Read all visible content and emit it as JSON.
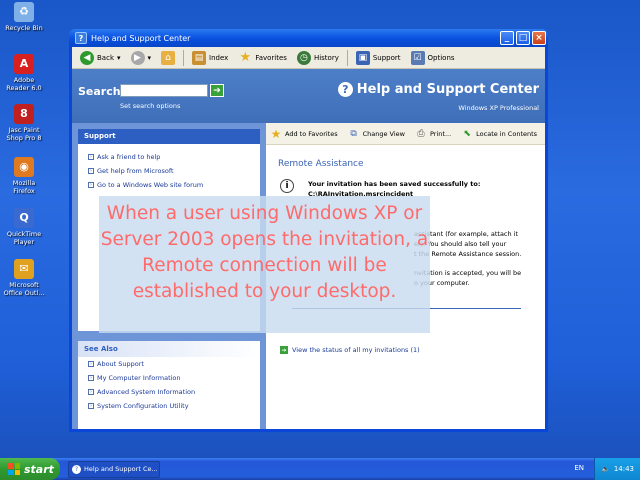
{
  "desktop": {
    "icons": [
      {
        "label": "Recycle Bin",
        "glyph": "♻",
        "color": "#7fb0e8"
      },
      {
        "label": "Adobe Reader 6.0",
        "glyph": "A",
        "color": "#d82020"
      },
      {
        "label": "Jasc Paint Shop Pro 8",
        "glyph": "8",
        "color": "#c02020"
      },
      {
        "label": "Mozilla Firefox",
        "glyph": "◉",
        "color": "#e07a20"
      },
      {
        "label": "QuickTime Player",
        "glyph": "Q",
        "color": "#3a6ad0"
      },
      {
        "label": "Microsoft Office Outl...",
        "glyph": "✉",
        "color": "#e0a020"
      }
    ]
  },
  "window": {
    "title": "Help and Support Center",
    "controls": {
      "minimize": "_",
      "maximize": "□",
      "close": "×"
    }
  },
  "toolbar": {
    "back": "Back",
    "index": "Index",
    "favorites": "Favorites",
    "history": "History",
    "support": "Support",
    "options": "Options"
  },
  "header": {
    "search_label": "Search",
    "search_value": "",
    "set_options": "Set search options",
    "title": "Help and Support Center",
    "subtitle": "Windows XP Professional"
  },
  "support_panel": {
    "heading": "Support",
    "items": [
      "Ask a friend to help",
      "Get help from Microsoft",
      "Go to a Windows Web site forum"
    ]
  },
  "see_also": {
    "heading": "See Also",
    "items": [
      "About Support",
      "My Computer Information",
      "Advanced System Information",
      "System Configuration Utility"
    ]
  },
  "content_toolbar": {
    "add_favorites": "Add to Favorites",
    "change_view": "Change View",
    "print": "Print...",
    "locate": "Locate in Contents"
  },
  "content": {
    "title": "Remote Assistance",
    "saved_line1": "Your invitation has been saved successfully to:",
    "saved_line2": "C:\\RAInvitation.msrcincident",
    "para1_line1": "assistant (for example, attach it",
    "para1_line2": "er). You should also tell your",
    "para1_line3": "t the Remote Assistance session.",
    "para2_line1": "nvitation is accepted, you will be",
    "para2_line2": "o your computer.",
    "status_link": "View the status of all my invitations (1)"
  },
  "caption": "When a user using Windows XP or Server 2003 opens the invitation, a Remote connection will be established to your desktop.",
  "taskbar": {
    "start": "start",
    "task": "Help and Support Ce...",
    "lang": "EN",
    "time": "14:43"
  }
}
